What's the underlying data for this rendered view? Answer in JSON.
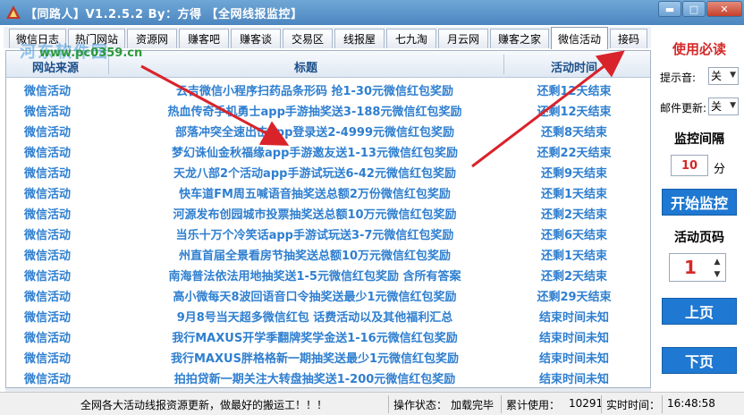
{
  "window": {
    "title": "【同路人】V1.2.5.2  By：方得 【全网线报监控】",
    "controls": {
      "minimize": "▬",
      "maximize": "□",
      "close": "✕"
    }
  },
  "tabs": [
    {
      "label": "微信日志",
      "active": false
    },
    {
      "label": "热门网站",
      "active": false
    },
    {
      "label": "资源网",
      "active": false
    },
    {
      "label": "赚客吧",
      "active": false
    },
    {
      "label": "赚客谈",
      "active": false
    },
    {
      "label": "交易区",
      "active": false
    },
    {
      "label": "线报屋",
      "active": false
    },
    {
      "label": "七九淘",
      "active": false
    },
    {
      "label": "月云网",
      "active": false
    },
    {
      "label": "赚客之家",
      "active": false
    },
    {
      "label": "微信活动",
      "active": true
    },
    {
      "label": "接码",
      "active": false
    }
  ],
  "table": {
    "headers": [
      "网站来源",
      "标题",
      "活动时间"
    ],
    "rows": [
      {
        "source": "微信活动",
        "title": "云吉微信小程序扫药品条形码 抢1-30元微信红包奖励",
        "time": "还剩12天结束"
      },
      {
        "source": "微信活动",
        "title": "热血传奇手机勇士app手游抽奖送3-188元微信红包奖励",
        "time": "还剩12天结束"
      },
      {
        "source": "微信活动",
        "title": "部落冲突全速出击app登录送2-4999元微信红包奖励",
        "time": "还剩8天结束"
      },
      {
        "source": "微信活动",
        "title": "梦幻诛仙金秋福缘app手游邀友送1-13元微信红包奖励",
        "time": "还剩22天结束"
      },
      {
        "source": "微信活动",
        "title": "天龙八部2个活动app手游试玩送6-42元微信红包奖励",
        "time": "还剩9天结束"
      },
      {
        "source": "微信活动",
        "title": "快车道FM周五喊语音抽奖送总额2万份微信红包奖励",
        "time": "还剩1天结束"
      },
      {
        "source": "微信活动",
        "title": "河源发布创园城市投票抽奖送总额10万元微信红包奖励",
        "time": "还剩2天结束"
      },
      {
        "source": "微信活动",
        "title": "当乐十万个冷笑话app手游试玩送3-7元微信红包奖励",
        "time": "还剩6天结束"
      },
      {
        "source": "微信活动",
        "title": "州直首届全景看房节抽奖送总额10万元微信红包奖励",
        "time": "还剩1天结束"
      },
      {
        "source": "微信活动",
        "title": "南海普法依法用地抽奖送1-5元微信红包奖励 含所有答案",
        "time": "还剩2天结束"
      },
      {
        "source": "微信活动",
        "title": "高小微每天8波回语音口令抽奖送最少1元微信红包奖励",
        "time": "还剩29天结束"
      },
      {
        "source": "微信活动",
        "title": "9月8号当天超多微信红包 话费活动以及其他福利汇总",
        "time": "结束时间未知"
      },
      {
        "source": "微信活动",
        "title": "我行MAXUS开学季翻牌奖学金送1-16元微信红包奖励",
        "time": "结束时间未知"
      },
      {
        "source": "微信活动",
        "title": "我行MAXUS胖格格新一期抽奖送最少1元微信红包奖励",
        "time": "结束时间未知"
      },
      {
        "source": "微信活动",
        "title": "拍拍贷新一期关注大转盘抽奖送1-200元微信红包奖励",
        "time": "结束时间未知"
      }
    ]
  },
  "panel": {
    "heading": "使用必读",
    "sound_label": "提示音:",
    "sound_value": "关",
    "mail_label": "邮件更新:",
    "mail_value": "关",
    "interval_label": "监控间隔",
    "interval_value": "10",
    "interval_unit": "分",
    "start_button": "开始监控",
    "page_label": "活动页码",
    "page_value": "1",
    "prev_button": "上页",
    "next_button": "下页"
  },
  "status": {
    "message": "全网各大活动线报资源更新，做最好的搬运工！！！",
    "op_label": "操作状态：",
    "op_value": "加载完毕",
    "total_label": "累计使用：",
    "total_value": "10291",
    "time_label": "实时时间：",
    "time_value": "16:48:58"
  },
  "watermark": {
    "main": "河东软件园",
    "url": "www.pc0359.cn"
  },
  "colors": {
    "link_blue": "#2f7fd0",
    "header_blue": "#1b4f8a",
    "accent_red": "#d62828",
    "button_blue": "#1f78d1",
    "arrow_red": "#d9232b"
  }
}
